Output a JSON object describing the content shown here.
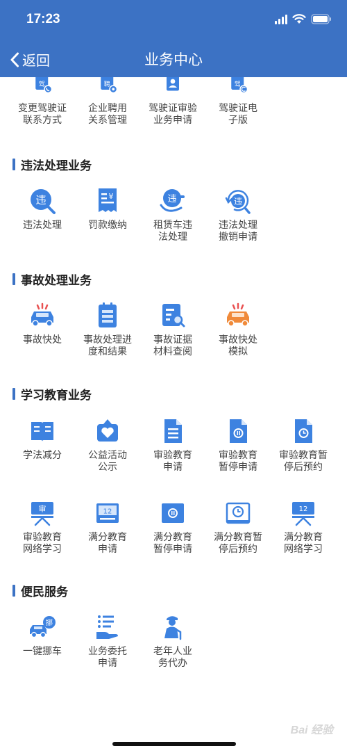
{
  "status_bar": {
    "time": "17:23"
  },
  "nav": {
    "back_label": "返回",
    "title": "业务中心"
  },
  "top_items": [
    {
      "label": "变更驾驶证\n联系方式",
      "icon": "license-phone-icon"
    },
    {
      "label": "企业聘用\n关系管理",
      "icon": "employment-icon"
    },
    {
      "label": "驾驶证审验\n业务申请",
      "icon": "license-review-icon"
    },
    {
      "label": "驾驶证电\n子版",
      "icon": "e-license-icon"
    }
  ],
  "sections": [
    {
      "title": "违法处理业务",
      "items": [
        {
          "label": "违法处理",
          "icon": "violation-search-icon"
        },
        {
          "label": "罚款缴纳",
          "icon": "fine-receipt-icon"
        },
        {
          "label": "租赁车违\n法处理",
          "icon": "rental-violation-icon"
        },
        {
          "label": "违法处理\n撤销申请",
          "icon": "violation-revoke-icon"
        }
      ]
    },
    {
      "title": "事故处理业务",
      "items": [
        {
          "label": "事故快处",
          "icon": "accident-car-icon"
        },
        {
          "label": "事故处理进\n度和结果",
          "icon": "accident-progress-icon"
        },
        {
          "label": "事故证据\n材料查阅",
          "icon": "evidence-search-icon"
        },
        {
          "label": "事故快处\n模拟",
          "icon": "accident-simulation-icon"
        }
      ]
    },
    {
      "title": "学习教育业务",
      "items": [
        {
          "label": "学法减分",
          "icon": "book-icon"
        },
        {
          "label": "公益活动\n公示",
          "icon": "charity-heart-icon"
        },
        {
          "label": "审验教育\n申请",
          "icon": "document-icon"
        },
        {
          "label": "审验教育\n暂停申请",
          "icon": "document-pause-icon"
        },
        {
          "label": "审验教育暂\n停后预约",
          "icon": "document-clock-icon"
        },
        {
          "label": "审验教育\n网络学习",
          "icon": "screen-shen-icon"
        },
        {
          "label": "满分教育\n申请",
          "icon": "calendar-12-icon"
        },
        {
          "label": "满分教育\n暂停申请",
          "icon": "screen-pause-icon"
        },
        {
          "label": "满分教育暂\n停后预约",
          "icon": "screen-clock-icon"
        },
        {
          "label": "满分教育\n网络学习",
          "icon": "screen-12-icon"
        }
      ]
    },
    {
      "title": "便民服务",
      "items": [
        {
          "label": "一键挪车",
          "icon": "move-car-icon"
        },
        {
          "label": "业务委托\n申请",
          "icon": "delegate-hand-icon"
        },
        {
          "label": "老年人业\n务代办",
          "icon": "elderly-person-icon"
        }
      ]
    }
  ],
  "icon_text": {
    "jia": "驾",
    "pin": "聘",
    "wei": "违",
    "yuan": "¥",
    "shen": "审",
    "twelve": "12",
    "nuo": "挪"
  },
  "watermark": "Bai 经验",
  "colors": {
    "primary": "#3c72c4",
    "icon_blue": "#3d82e0",
    "icon_light": "#d6e6fb",
    "accident_orange": "#f08a3a",
    "siren_red": "#e95252"
  }
}
